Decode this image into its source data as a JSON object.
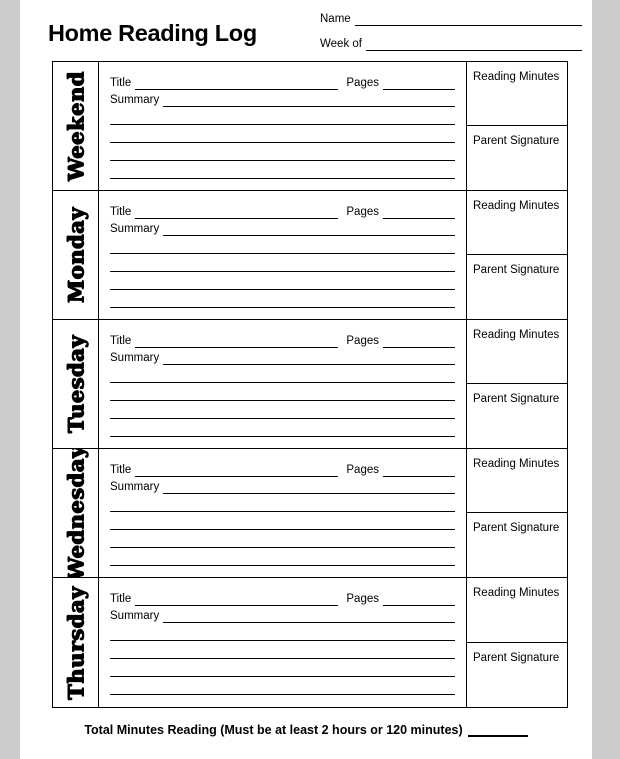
{
  "header": {
    "title": "Home Reading Log",
    "fields": [
      {
        "label": "Name"
      },
      {
        "label": "Week of"
      }
    ]
  },
  "table": {
    "entry_labels": {
      "title": "Title",
      "pages": "Pages",
      "summary": "Summary"
    },
    "meta_labels": {
      "reading_minutes": "Reading Minutes",
      "parent_signature": "Parent Signature"
    },
    "blank_lines_per_row": 4,
    "rows": [
      {
        "day": "Weekend"
      },
      {
        "day": "Monday"
      },
      {
        "day": "Tuesday"
      },
      {
        "day": "Wednesday"
      },
      {
        "day": "Thursday"
      }
    ]
  },
  "footer": {
    "text": "Total Minutes Reading (Must be at least 2 hours or 120 minutes)"
  },
  "colors": {
    "page_background": "#cccccc",
    "sheet": "#ffffff",
    "ink": "#000000"
  }
}
